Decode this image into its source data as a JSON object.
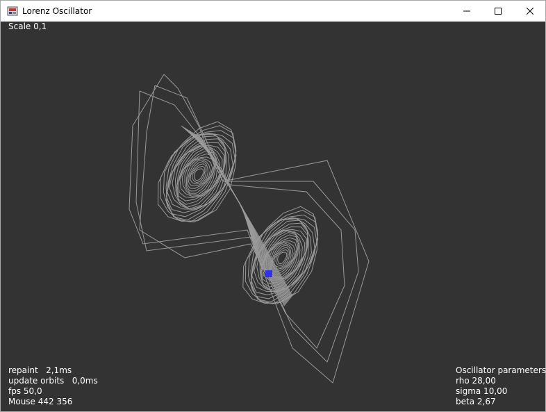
{
  "window": {
    "title": "Lorenz Oscillator",
    "icon": "java-app-icon"
  },
  "titlebar_buttons": {
    "minimize": "minimize-icon",
    "maximize": "maximize-icon",
    "close": "close-icon"
  },
  "overlay": {
    "scale": "Scale 0,1",
    "stats": {
      "repaint": "repaint   2,1ms",
      "update_orbits": "update orbits   0,0ms",
      "fps": "fps 50,0",
      "mouse": "Mouse 442 356"
    },
    "parameters": {
      "header": "Oscillator parameters",
      "rho": "rho 28,00",
      "sigma": "sigma 10,00",
      "beta": "beta 2,67"
    }
  },
  "colors": {
    "background": "#333333",
    "trajectory": "#9a9a9a",
    "marker": "#2222ff",
    "text": "#ffffff"
  }
}
